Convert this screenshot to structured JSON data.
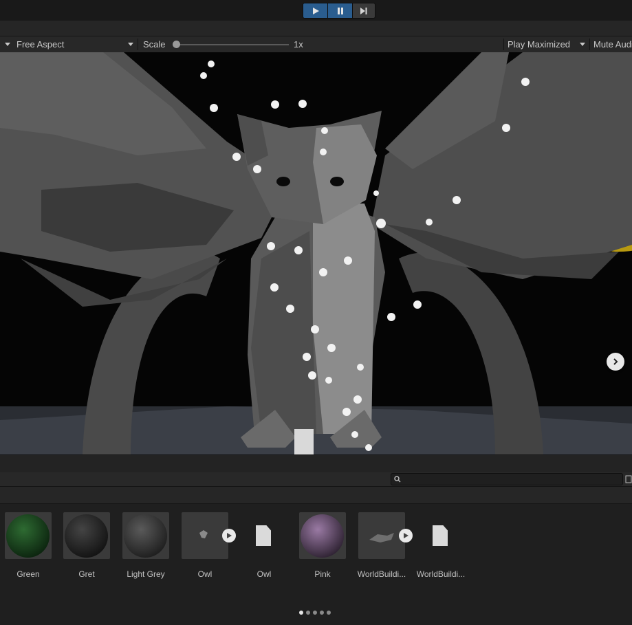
{
  "play_controls": {
    "play": "play-icon",
    "pause": "pause-icon",
    "step": "step-icon"
  },
  "game_toolbar": {
    "aspect": "Free Aspect",
    "scale_label": "Scale",
    "scale_value": "1x",
    "scale_level": 0,
    "play_mode": "Play Maximized",
    "mute": "Mute Audio"
  },
  "project": {
    "search_placeholder": "",
    "assets": [
      {
        "label": "Green",
        "kind": "material",
        "color": "#1f4a22"
      },
      {
        "label": "Gret",
        "kind": "material",
        "color": "#2c2c2c"
      },
      {
        "label": "Light Grey",
        "kind": "material",
        "color": "#3d3d3d"
      },
      {
        "label": "Owl",
        "kind": "model"
      },
      {
        "label": "Owl",
        "kind": "file"
      },
      {
        "label": "Pink",
        "kind": "material",
        "color": "#6e5575"
      },
      {
        "label": "WorldBuildi...",
        "kind": "model"
      },
      {
        "label": "WorldBuildi...",
        "kind": "file"
      }
    ]
  },
  "pager": {
    "pages": 5,
    "current": 1
  },
  "colors": {
    "accent": "#2a5d8f",
    "moon": "#b89a10",
    "background": "#1e1e1e"
  }
}
